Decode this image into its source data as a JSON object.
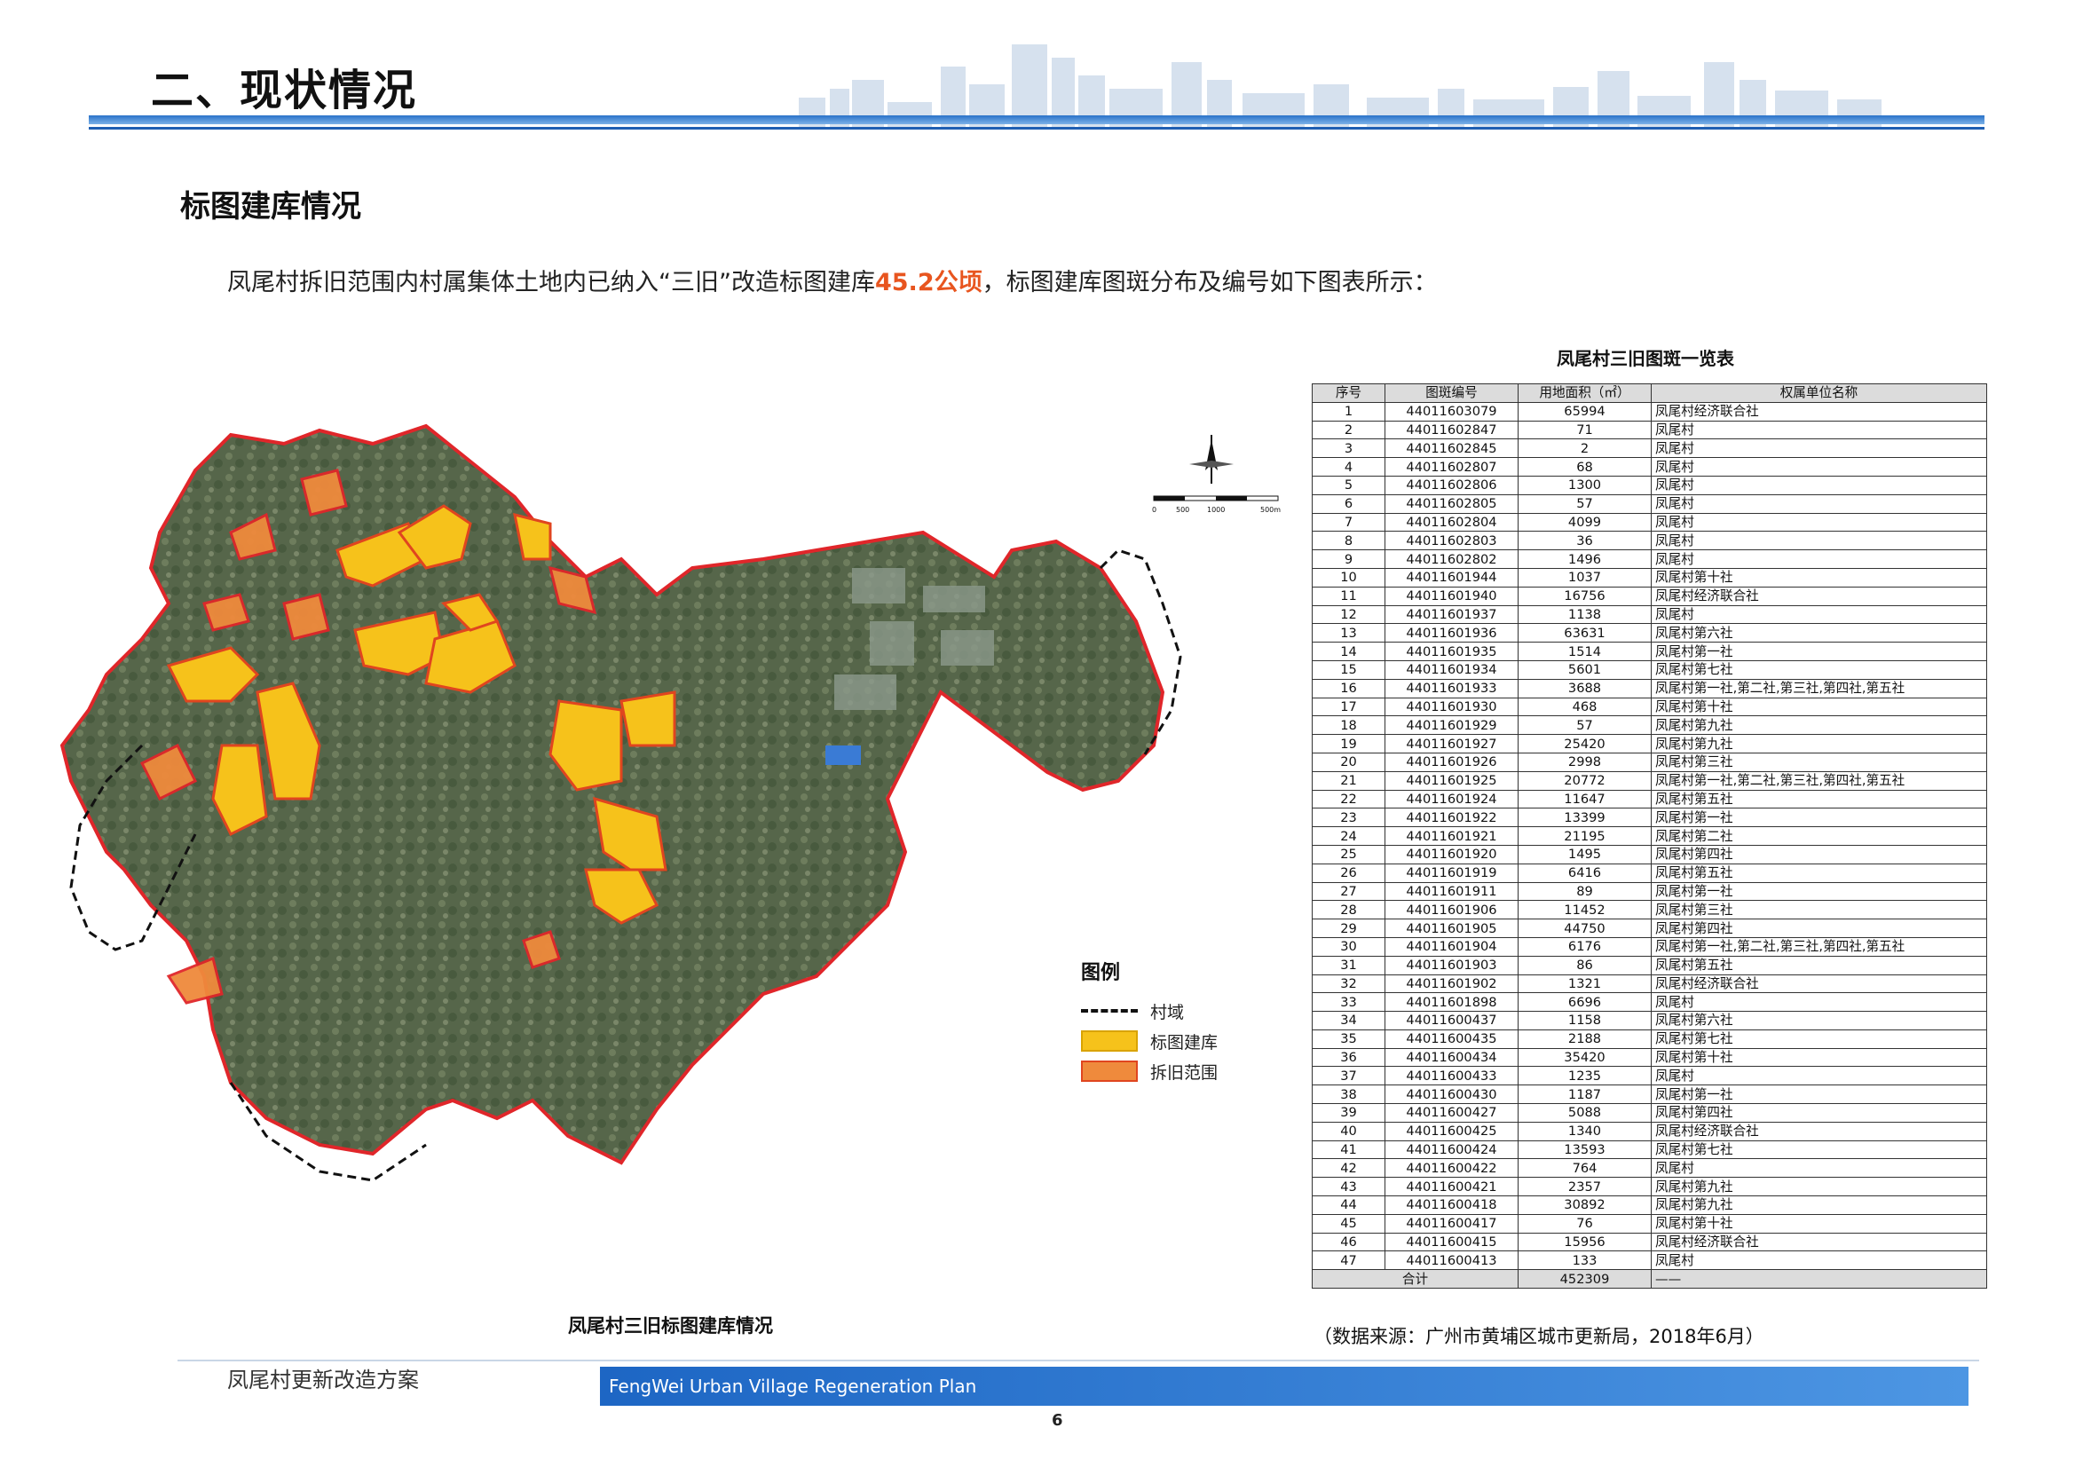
{
  "header": {
    "title": "二、现状情况"
  },
  "section": {
    "title": "标图建库情况",
    "intro_before": "凤尾村拆旧范围内村属集体土地内已纳入“三旧”改造标图建库",
    "intro_highlight": "45.2公顷",
    "intro_after": "，标图建库图斑分布及编号如下图表所示："
  },
  "map": {
    "caption": "凤尾村三旧标图建库情况",
    "legend": {
      "title": "图例",
      "items": [
        {
          "label": "村域"
        },
        {
          "label": "标图建库"
        },
        {
          "label": "拆旧范围"
        }
      ]
    },
    "scale": {
      "ticks": [
        "0",
        "500",
        "1000",
        "500m"
      ]
    },
    "colors": {
      "boundary": "#e0262a",
      "biaotu_fill": "#f6c21b",
      "chaijiu_fill": "#ef8a3c",
      "terrain": "#5b6b4e"
    }
  },
  "table": {
    "title": "凤尾村三旧图斑一览表",
    "headers": [
      "序号",
      "图斑编号",
      "用地面积（㎡）",
      "权属单位名称"
    ],
    "rows": [
      [
        "1",
        "44011603079",
        "65994",
        "凤尾村经济联合社"
      ],
      [
        "2",
        "44011602847",
        "71",
        "凤尾村"
      ],
      [
        "3",
        "44011602845",
        "2",
        "凤尾村"
      ],
      [
        "4",
        "44011602807",
        "68",
        "凤尾村"
      ],
      [
        "5",
        "44011602806",
        "1300",
        "凤尾村"
      ],
      [
        "6",
        "44011602805",
        "57",
        "凤尾村"
      ],
      [
        "7",
        "44011602804",
        "4099",
        "凤尾村"
      ],
      [
        "8",
        "44011602803",
        "36",
        "凤尾村"
      ],
      [
        "9",
        "44011602802",
        "1496",
        "凤尾村"
      ],
      [
        "10",
        "44011601944",
        "1037",
        "凤尾村第十社"
      ],
      [
        "11",
        "44011601940",
        "16756",
        "凤尾村经济联合社"
      ],
      [
        "12",
        "44011601937",
        "1138",
        "凤尾村"
      ],
      [
        "13",
        "44011601936",
        "63631",
        "凤尾村第六社"
      ],
      [
        "14",
        "44011601935",
        "1514",
        "凤尾村第一社"
      ],
      [
        "15",
        "44011601934",
        "5601",
        "凤尾村第七社"
      ],
      [
        "16",
        "44011601933",
        "3688",
        "凤尾村第一社,第二社,第三社,第四社,第五社"
      ],
      [
        "17",
        "44011601930",
        "468",
        "凤尾村第十社"
      ],
      [
        "18",
        "44011601929",
        "57",
        "凤尾村第九社"
      ],
      [
        "19",
        "44011601927",
        "25420",
        "凤尾村第九社"
      ],
      [
        "20",
        "44011601926",
        "2998",
        "凤尾村第三社"
      ],
      [
        "21",
        "44011601925",
        "20772",
        "凤尾村第一社,第二社,第三社,第四社,第五社"
      ],
      [
        "22",
        "44011601924",
        "11647",
        "凤尾村第五社"
      ],
      [
        "23",
        "44011601922",
        "13399",
        "凤尾村第一社"
      ],
      [
        "24",
        "44011601921",
        "21195",
        "凤尾村第二社"
      ],
      [
        "25",
        "44011601920",
        "1495",
        "凤尾村第四社"
      ],
      [
        "26",
        "44011601919",
        "6416",
        "凤尾村第五社"
      ],
      [
        "27",
        "44011601911",
        "89",
        "凤尾村第一社"
      ],
      [
        "28",
        "44011601906",
        "11452",
        "凤尾村第三社"
      ],
      [
        "29",
        "44011601905",
        "44750",
        "凤尾村第四社"
      ],
      [
        "30",
        "44011601904",
        "6176",
        "凤尾村第一社,第二社,第三社,第四社,第五社"
      ],
      [
        "31",
        "44011601903",
        "86",
        "凤尾村第五社"
      ],
      [
        "32",
        "44011601902",
        "1321",
        "凤尾村经济联合社"
      ],
      [
        "33",
        "44011601898",
        "6696",
        "凤尾村"
      ],
      [
        "34",
        "44011600437",
        "1158",
        "凤尾村第六社"
      ],
      [
        "35",
        "44011600435",
        "2188",
        "凤尾村第七社"
      ],
      [
        "36",
        "44011600434",
        "35420",
        "凤尾村第十社"
      ],
      [
        "37",
        "44011600433",
        "1235",
        "凤尾村"
      ],
      [
        "38",
        "44011600430",
        "1187",
        "凤尾村第一社"
      ],
      [
        "39",
        "44011600427",
        "5088",
        "凤尾村第四社"
      ],
      [
        "40",
        "44011600425",
        "1340",
        "凤尾村经济联合社"
      ],
      [
        "41",
        "44011600424",
        "13593",
        "凤尾村第七社"
      ],
      [
        "42",
        "44011600422",
        "764",
        "凤尾村"
      ],
      [
        "43",
        "44011600421",
        "2357",
        "凤尾村第九社"
      ],
      [
        "44",
        "44011600418",
        "30892",
        "凤尾村第九社"
      ],
      [
        "45",
        "44011600417",
        "76",
        "凤尾村第十社"
      ],
      [
        "46",
        "44011600415",
        "15956",
        "凤尾村经济联合社"
      ],
      [
        "47",
        "44011600413",
        "133",
        "凤尾村"
      ]
    ],
    "total": {
      "label": "合计",
      "area": "452309",
      "owner": "——"
    },
    "source": "（数据来源：广州市黄埔区城市更新局，2018年6月）"
  },
  "footer": {
    "left": "凤尾村更新改造方案",
    "english": "FengWei Urban Village Regeneration Plan",
    "page": "6"
  }
}
